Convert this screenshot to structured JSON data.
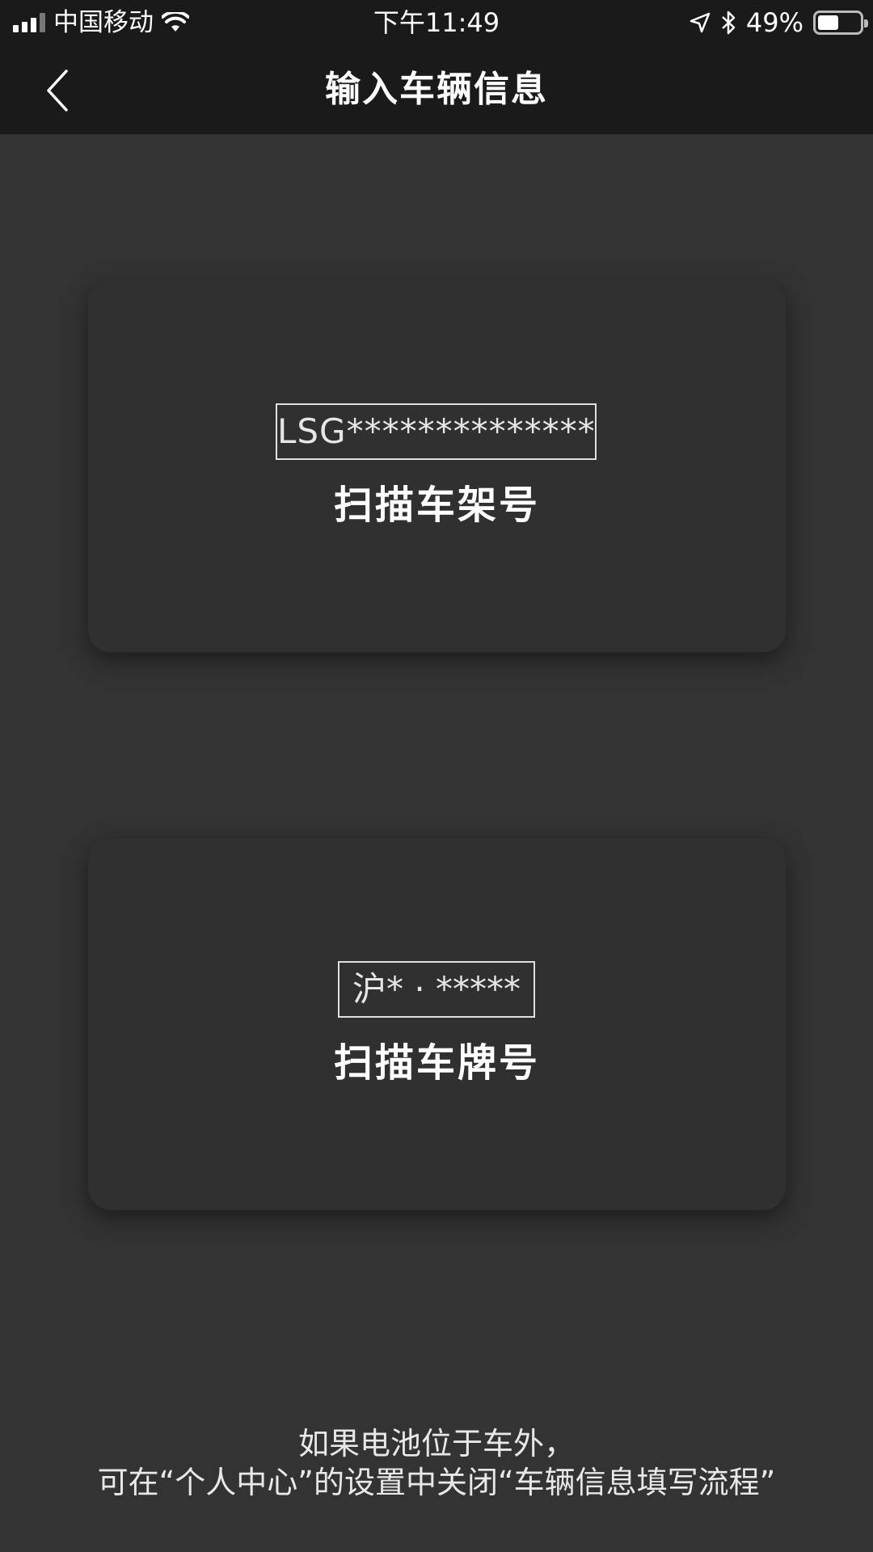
{
  "status_bar": {
    "carrier": "中国移动",
    "time": "下午11:49",
    "battery_percent": "49%",
    "battery_level": 0.49,
    "icons": [
      "signal-icon",
      "wifi-icon",
      "location-icon",
      "bluetooth-icon",
      "battery-icon"
    ]
  },
  "nav": {
    "title": "输入车辆信息",
    "back_icon": "chevron-left-icon"
  },
  "cards": {
    "vin": {
      "sample": "LSG**************",
      "label": "扫描车架号"
    },
    "plate": {
      "sample": "沪* · *****",
      "label": "扫描车牌号"
    }
  },
  "footer": {
    "line1": "如果电池位于车外，",
    "line2": "可在“个人中心”的设置中关闭“车辆信息填写流程”"
  },
  "colors": {
    "background": "#333333",
    "bar": "#1a1a1a",
    "card": "#303030",
    "text": "#ffffff"
  }
}
